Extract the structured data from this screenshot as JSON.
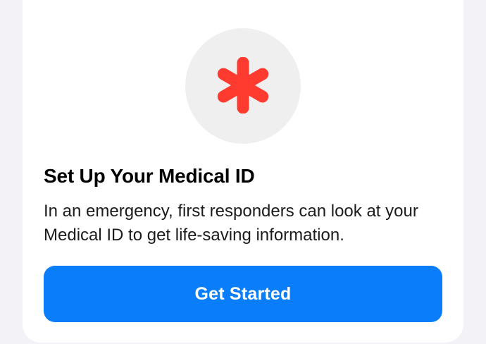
{
  "medical_id_card": {
    "icon": "asterisk-icon",
    "title": "Set Up Your Medical ID",
    "description": "In an emergency, first responders can look at your Medical ID to get life-saving information.",
    "button_label": "Get Started"
  },
  "colors": {
    "accent": "#0a7dfa",
    "icon_color": "#ff3b30",
    "icon_background": "#efefef",
    "card_background": "#ffffff",
    "page_background": "#f2f2f7"
  }
}
